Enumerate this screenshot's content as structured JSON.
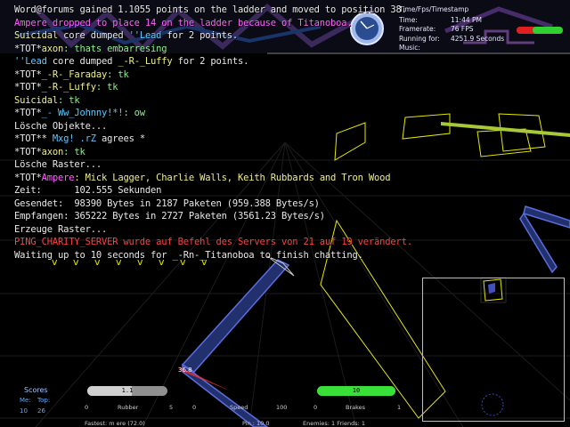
{
  "console": [
    {
      "parts": [
        {
          "t": "Word@forums gained 1.1055 points on the ladder and moved to position 38.",
          "c": "w"
        }
      ]
    },
    {
      "parts": [
        {
          "t": "Ampere dropped to place 14 on the ladder because of Titanoboa.",
          "c": "mg"
        }
      ]
    },
    {
      "parts": [
        {
          "t": "Suicidal",
          "c": "y"
        },
        {
          "t": " core dumped ",
          "c": "w"
        },
        {
          "t": "''Lead",
          "c": "cy"
        },
        {
          "t": " for 2 points.",
          "c": "w"
        }
      ]
    },
    {
      "parts": [
        {
          "t": "*TOT*",
          "c": "w"
        },
        {
          "t": "axon",
          "c": "y"
        },
        {
          "t": ": thats embarresing",
          "c": "g"
        }
      ]
    },
    {
      "parts": [
        {
          "t": "''Lead",
          "c": "cy"
        },
        {
          "t": " core dumped ",
          "c": "w"
        },
        {
          "t": "_-R-_Luffy",
          "c": "y"
        },
        {
          "t": " for 2 points.",
          "c": "w"
        }
      ]
    },
    {
      "parts": [
        {
          "t": "*TOT*",
          "c": "w"
        },
        {
          "t": "_-R-_Faraday",
          "c": "y"
        },
        {
          "t": ": tk",
          "c": "g"
        }
      ]
    },
    {
      "parts": [
        {
          "t": "*TOT*",
          "c": "w"
        },
        {
          "t": "_-R-_Luffy",
          "c": "y"
        },
        {
          "t": ": tk",
          "c": "g"
        }
      ]
    },
    {
      "parts": [
        {
          "t": "Suicidal",
          "c": "y"
        },
        {
          "t": ": tk",
          "c": "g"
        }
      ]
    },
    {
      "parts": [
        {
          "t": "*TOT*",
          "c": "w"
        },
        {
          "t": "_- Ww_Johnny!*!",
          "c": "cy"
        },
        {
          "t": ": ow",
          "c": "g"
        }
      ]
    },
    {
      "parts": [
        {
          "t": "Lösche Objekte...",
          "c": "w"
        }
      ]
    },
    {
      "parts": [
        {
          "t": "*TOT** ",
          "c": "w"
        },
        {
          "t": "Mxg! .rZ",
          "c": "cy"
        },
        {
          "t": " agrees *",
          "c": "w"
        }
      ]
    },
    {
      "parts": [
        {
          "t": "*TOT*",
          "c": "w"
        },
        {
          "t": "axon",
          "c": "y"
        },
        {
          "t": ": tk",
          "c": "g"
        }
      ]
    },
    {
      "parts": [
        {
          "t": "Lösche Raster...",
          "c": "w"
        }
      ]
    },
    {
      "parts": [
        {
          "t": "*TOT*",
          "c": "w"
        },
        {
          "t": "Ampere",
          "c": "mg"
        },
        {
          "t": ": Mick Lagger, Charlie Walls, Keith Rubbards and Tron Wood",
          "c": "y"
        }
      ]
    },
    {
      "parts": [
        {
          "t": "Zeit:      102.555 Sekunden",
          "c": "w"
        }
      ]
    },
    {
      "parts": [
        {
          "t": "Gesendet:  98390 Bytes in 2187 Paketen (959.388 Bytes/s)",
          "c": "w"
        }
      ]
    },
    {
      "parts": [
        {
          "t": "Empfangen: 365222 Bytes in 2727 Paketen (3561.23 Bytes/s)",
          "c": "w"
        }
      ]
    },
    {
      "parts": [
        {
          "t": "Erzeuge Raster...",
          "c": "w"
        }
      ]
    },
    {
      "parts": [
        {
          "t": "PING_CHARITY_SERVER wurde auf Befehl des Servers von 21 auf 19 verändert.",
          "c": "r"
        }
      ]
    },
    {
      "parts": [
        {
          "t": "Waiting up to 10 seconds for _-Rn-_Titanoboa to finish chatting.",
          "c": "w"
        }
      ]
    }
  ],
  "vmarks": "v     v     v     v     v     v     v     v",
  "info": {
    "rows": [
      {
        "k": "Time:",
        "v": "11:44 PM"
      },
      {
        "k": "Framerate:",
        "v": "76 FPS"
      },
      {
        "k": "Running for:",
        "v": "4251.9 Seconds"
      },
      {
        "k": "Music:",
        "v": ""
      }
    ],
    "header": "Time/Fps/Timestamp"
  },
  "scores": {
    "title": "Scores",
    "me_label": "Me:",
    "top_label": "Top:",
    "me_value": "10",
    "top_value": "26"
  },
  "hud": {
    "rubber_bar_value": "1.1",
    "rubber_fill": 0.55,
    "rubber_label": "Rubber",
    "rubber_min": "0",
    "rubber_max": "5",
    "speed_bar_value": "10",
    "speed_fill": 1.0,
    "speed_label": "Speed",
    "speed_min": "0",
    "speed_max": "100",
    "brakes_label": "Brakes",
    "brakes_min": "0",
    "brakes_max": "1",
    "speed_marker": "36.8",
    "fastest": "Fastest:  m ere (72.0)",
    "pin": "Pin :  10.0",
    "enemies": "Enemies: 1 Friends: 1"
  },
  "colors": {
    "grid": "#1a1a1a",
    "wall_blue": "#3a4ea8",
    "zone_yellow": "#e8e800",
    "bar_green": "#2fd02f",
    "bar_grey": "#9a9a9a",
    "minimap_border": "#bdbdbd"
  }
}
